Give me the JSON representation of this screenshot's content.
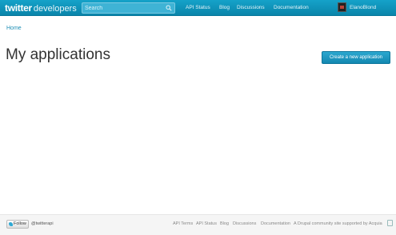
{
  "header": {
    "brand_twitter": "twitter",
    "brand_developers": "developers",
    "search_placeholder": "Search",
    "nav": [
      "API Status",
      "Blog",
      "Discussions",
      "Documentation"
    ],
    "username": "ElanoBlond"
  },
  "breadcrumb": "Home",
  "page_title": "My applications",
  "create_button": "Create a new application",
  "footer": {
    "follow_label": "Follow",
    "handle": "@twitterapi",
    "links": [
      "API Terms",
      "API Status",
      "Blog",
      "Discussions",
      "Documentation"
    ],
    "tagline": "A Drupal community site supported by Acquia"
  },
  "colors": {
    "header_bg": "#0f97c0",
    "accent_link": "#1f8fb5",
    "button_bg": "#1e97c2"
  },
  "icons": {
    "search": "search-icon",
    "avatar": "user-avatar",
    "follow": "twitter-bird-icon",
    "acquia": "acquia-logo"
  }
}
